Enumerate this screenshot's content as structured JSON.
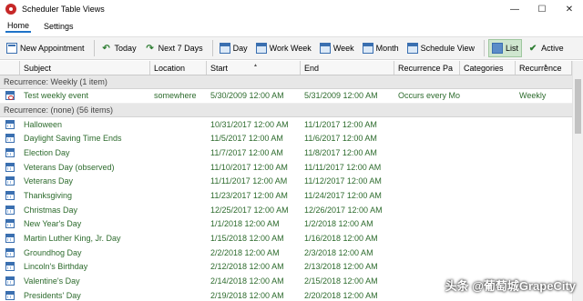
{
  "window": {
    "title": "Scheduler Table Views"
  },
  "window_buttons": [
    "—",
    "☐",
    "✕"
  ],
  "menu": {
    "items": [
      "Home",
      "Settings"
    ]
  },
  "toolbar": {
    "new_appointment": "New Appointment",
    "today": "Today",
    "next_7_days": "Next 7 Days",
    "day": "Day",
    "work_week": "Work Week",
    "week": "Week",
    "month": "Month",
    "schedule_view": "Schedule View",
    "list": "List",
    "active": "Active"
  },
  "columns": [
    "Subject",
    "Location",
    "Start",
    "End",
    "Recurrence Pa",
    "Categories",
    "Recurrence"
  ],
  "groups": [
    {
      "label": "Recurrence: Weekly (1 item)",
      "rows": [
        {
          "subject": "Test weekly event",
          "location": "somewhere",
          "start": "5/30/2009 12:00 AM",
          "end": "5/31/2009 12:00 AM",
          "pattern": "Occurs every Mon",
          "categories": "",
          "recurrence": "Weekly"
        }
      ]
    },
    {
      "label": "Recurrence: (none) (56 items)",
      "rows": [
        {
          "subject": "Halloween",
          "start": "10/31/2017 12:00 AM",
          "end": "11/1/2017 12:00 AM"
        },
        {
          "subject": "Daylight Saving Time Ends",
          "start": "11/5/2017 12:00 AM",
          "end": "11/6/2017 12:00 AM"
        },
        {
          "subject": "Election Day",
          "start": "11/7/2017 12:00 AM",
          "end": "11/8/2017 12:00 AM"
        },
        {
          "subject": "Veterans Day (observed)",
          "start": "11/10/2017 12:00 AM",
          "end": "11/11/2017 12:00 AM"
        },
        {
          "subject": "Veterans Day",
          "start": "11/11/2017 12:00 AM",
          "end": "11/12/2017 12:00 AM"
        },
        {
          "subject": "Thanksgiving",
          "start": "11/23/2017 12:00 AM",
          "end": "11/24/2017 12:00 AM"
        },
        {
          "subject": "Christmas Day",
          "start": "12/25/2017 12:00 AM",
          "end": "12/26/2017 12:00 AM"
        },
        {
          "subject": "New Year's Day",
          "start": "1/1/2018 12:00 AM",
          "end": "1/2/2018 12:00 AM"
        },
        {
          "subject": "Martin Luther King, Jr. Day",
          "start": "1/15/2018 12:00 AM",
          "end": "1/16/2018 12:00 AM"
        },
        {
          "subject": "Groundhog Day",
          "start": "2/2/2018 12:00 AM",
          "end": "2/3/2018 12:00 AM"
        },
        {
          "subject": "Lincoln's Birthday",
          "start": "2/12/2018 12:00 AM",
          "end": "2/13/2018 12:00 AM"
        },
        {
          "subject": "Valentine's Day",
          "start": "2/14/2018 12:00 AM",
          "end": "2/15/2018 12:00 AM"
        },
        {
          "subject": "Presidents' Day",
          "start": "2/19/2018 12:00 AM",
          "end": "2/20/2018 12:00 AM"
        }
      ]
    }
  ],
  "watermark": "头条 @葡萄城GrapeCity"
}
